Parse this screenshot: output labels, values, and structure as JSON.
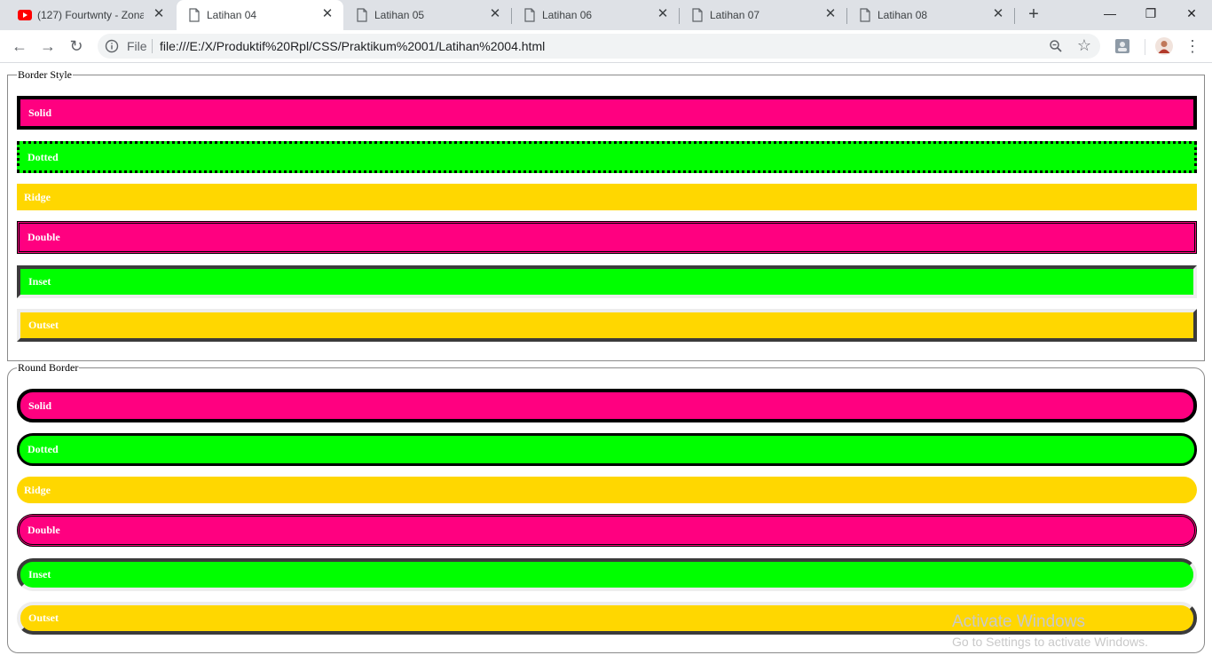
{
  "tabs": [
    {
      "title": "(127) Fourtwnty - Zona",
      "icon": "youtube-icon",
      "active": false
    },
    {
      "title": "Latihan 04",
      "icon": "document-icon",
      "active": true
    },
    {
      "title": "Latihan 05",
      "icon": "document-icon",
      "active": false
    },
    {
      "title": "Latihan 06",
      "icon": "document-icon",
      "active": false
    },
    {
      "title": "Latihan 07",
      "icon": "document-icon",
      "active": false
    },
    {
      "title": "Latihan 08",
      "icon": "document-icon",
      "active": false
    }
  ],
  "window_controls": {
    "minimize": "—",
    "restore": "❐",
    "close": "✕"
  },
  "toolbar": {
    "back": "←",
    "forward": "→",
    "reload": "↻",
    "scheme_label": "File",
    "url": "file:///E:/X/Produktif%20Rpl/CSS/Praktikum%2001/Latihan%2004.html",
    "star": "☆",
    "menu": "⋮"
  },
  "page": {
    "border_style": {
      "legend": "Border Style",
      "boxes": [
        {
          "label": "Solid",
          "color": "#ff0080"
        },
        {
          "label": "Dotted",
          "color": "#00ff00"
        },
        {
          "label": "Ridge",
          "color": "#ffd700"
        },
        {
          "label": "Double",
          "color": "#ff0080"
        },
        {
          "label": "Inset",
          "color": "#00ff00"
        },
        {
          "label": "Outset",
          "color": "#ffd700"
        }
      ]
    },
    "round_border": {
      "legend": "Round Border",
      "boxes": [
        {
          "label": "Solid",
          "color": "#ff0080"
        },
        {
          "label": "Dotted",
          "color": "#00ff00"
        },
        {
          "label": "Ridge",
          "color": "#ffd700"
        },
        {
          "label": "Double",
          "color": "#ff0080"
        },
        {
          "label": "Inset",
          "color": "#00ff00"
        },
        {
          "label": "Outset",
          "color": "#ffd700"
        }
      ]
    }
  },
  "watermark": {
    "line1": "Activate Windows",
    "line2": "Go to Settings to activate Windows."
  }
}
